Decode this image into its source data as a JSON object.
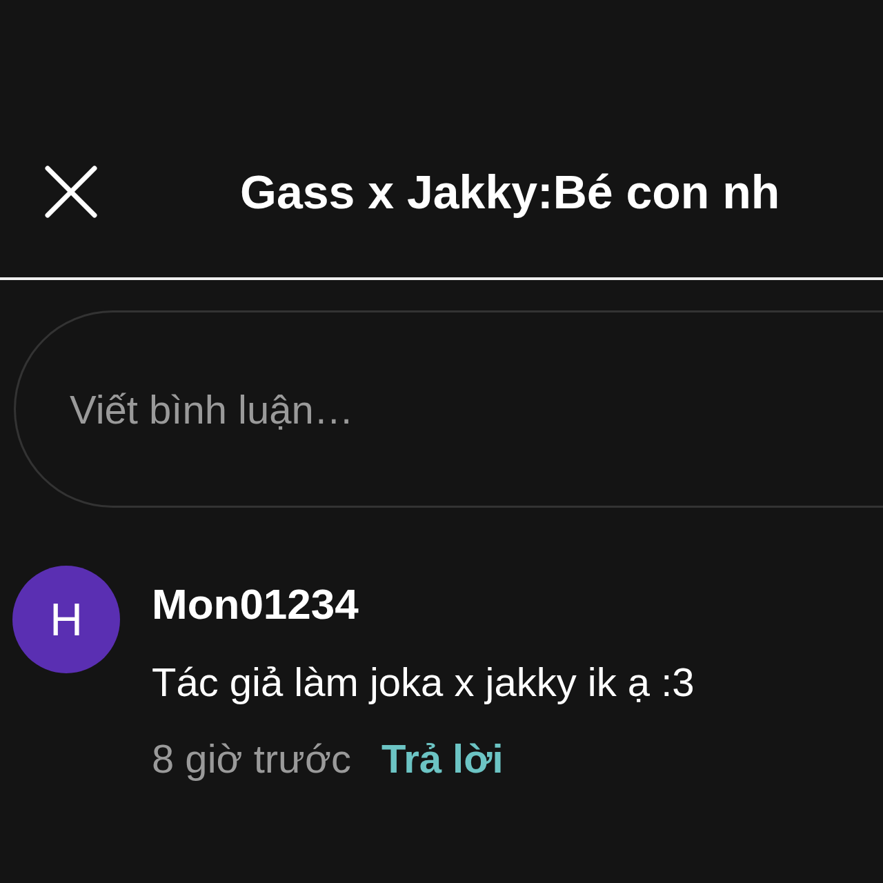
{
  "header": {
    "title": "Gass x Jakky:Bé con nh"
  },
  "comment_field": {
    "placeholder": "Viết bình luận…"
  },
  "comments": [
    {
      "avatar": "H",
      "color": "#5a2fb2",
      "user": "Mon01234",
      "text": "Tác giả làm joka x jakky ik ạ :3",
      "time": "8 giờ trước",
      "reply": "Trả lời"
    }
  ]
}
